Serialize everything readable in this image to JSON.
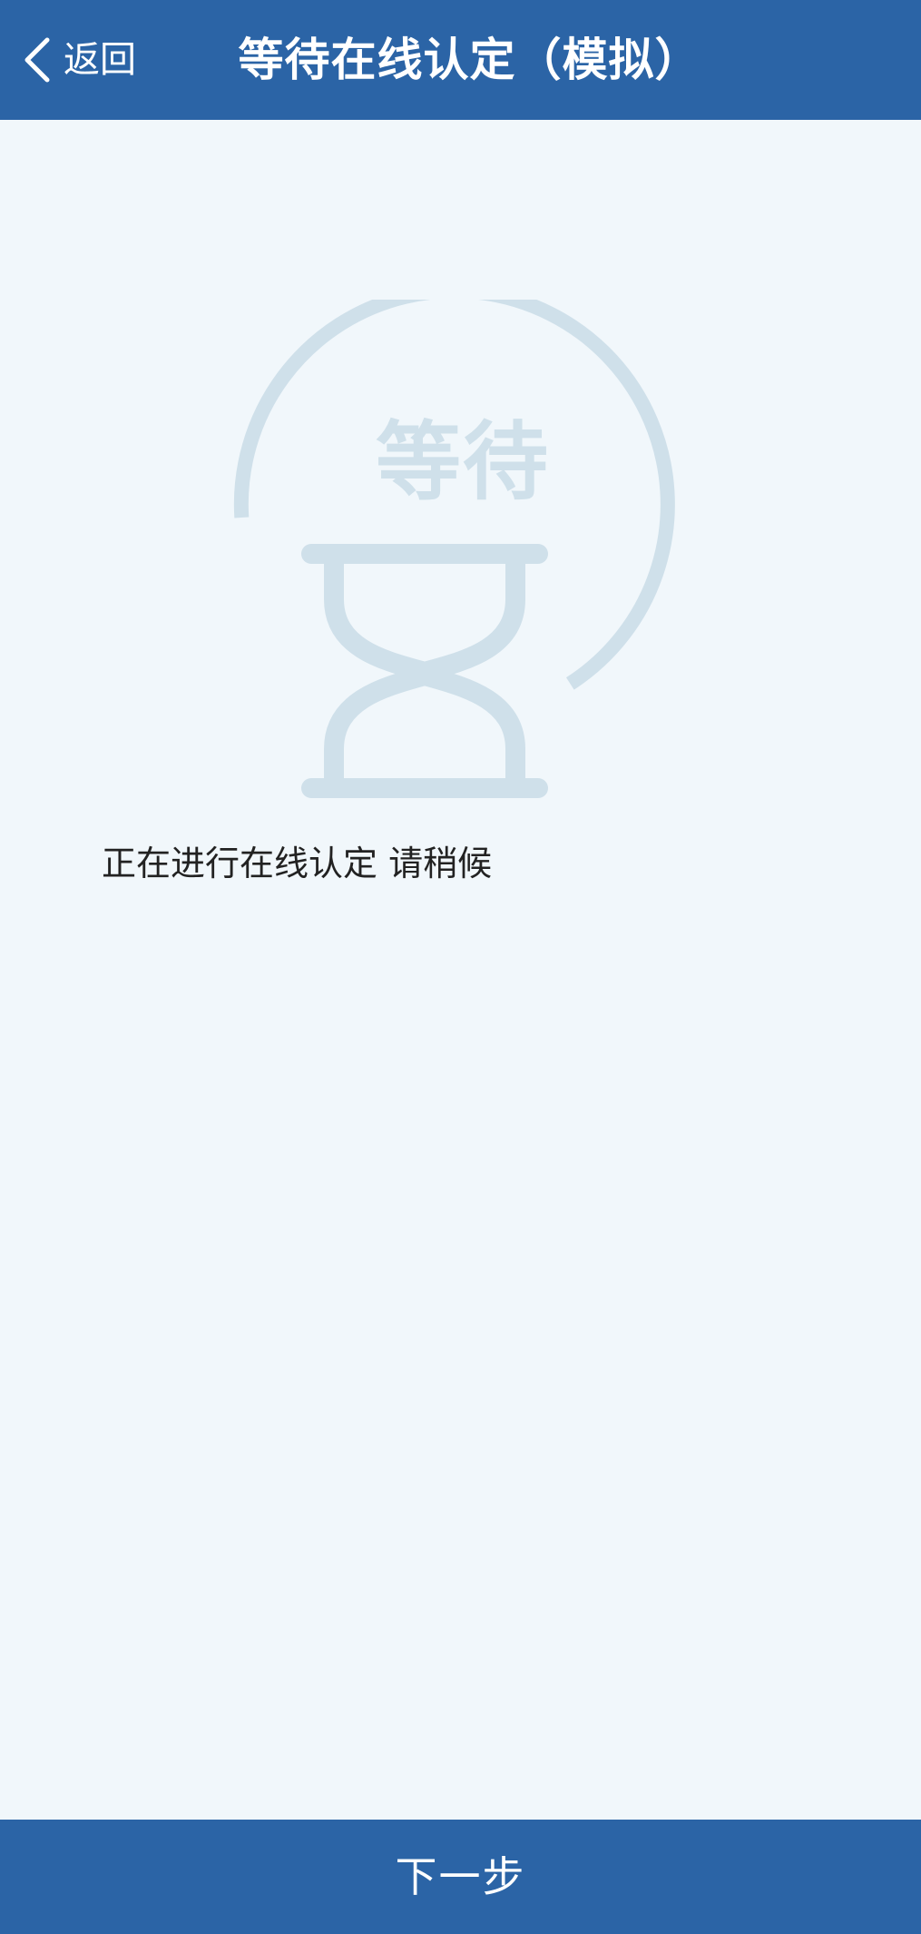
{
  "header": {
    "back_label": "返回",
    "title": "等待在线认定（模拟）"
  },
  "illustration": {
    "label": "等待",
    "icon": "hourglass-icon"
  },
  "status": {
    "message": "正在进行在线认定 请稍候"
  },
  "footer": {
    "next_label": "下一步"
  },
  "colors": {
    "header_bg": "#2b64a6",
    "page_bg": "#f1f7fb",
    "illustration": "#cfe0ea",
    "text": "#222222"
  }
}
